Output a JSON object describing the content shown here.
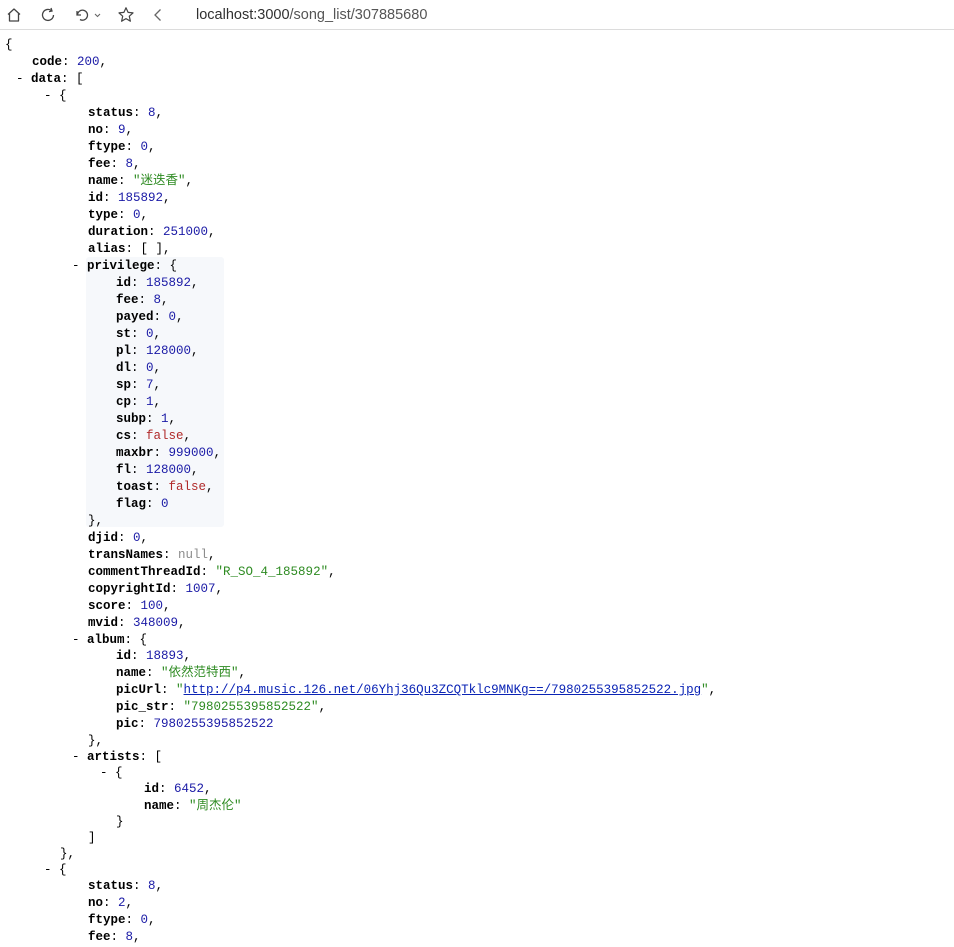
{
  "browser": {
    "url_host": "localhost:3000",
    "url_path": "/song_list/307885680",
    "icons": [
      "home-icon",
      "refresh-icon",
      "undo-icon",
      "star-icon",
      "back-icon"
    ]
  },
  "json_view": {
    "keys": {
      "code": "code",
      "data": "data",
      "status": "status",
      "no": "no",
      "ftype": "ftype",
      "fee": "fee",
      "name": "name",
      "id": "id",
      "type": "type",
      "duration": "duration",
      "alias": "alias",
      "privilege": "privilege",
      "payed": "payed",
      "st": "st",
      "pl": "pl",
      "dl": "dl",
      "sp": "sp",
      "cp": "cp",
      "subp": "subp",
      "cs": "cs",
      "maxbr": "maxbr",
      "fl": "fl",
      "toast": "toast",
      "flag": "flag",
      "djid": "djid",
      "transNames": "transNames",
      "commentThreadId": "commentThreadId",
      "copyrightId": "copyrightId",
      "score": "score",
      "mvid": "mvid",
      "album": "album",
      "picUrl": "picUrl",
      "pic_str": "pic_str",
      "pic": "pic",
      "artists": "artists"
    },
    "code": "200",
    "song1": {
      "status": "8",
      "no": "9",
      "ftype": "0",
      "fee": "8",
      "name": "\"迷迭香\"",
      "id": "185892",
      "type": "0",
      "duration": "251000",
      "alias": "[ ]",
      "privilege": {
        "id": "185892",
        "fee": "8",
        "payed": "0",
        "st": "0",
        "pl": "128000",
        "dl": "0",
        "sp": "7",
        "cp": "1",
        "subp": "1",
        "cs": "false",
        "maxbr": "999000",
        "fl": "128000",
        "toast": "false",
        "flag": "0"
      },
      "djid": "0",
      "transNames": "null",
      "commentThreadId": "\"R_SO_4_185892\"",
      "copyrightId": "1007",
      "score": "100",
      "mvid": "348009",
      "album": {
        "id": "18893",
        "name": "\"依然范特西\"",
        "picUrl": "http://p4.music.126.net/06Yhj36Qu3ZCQTklc9MNKg==/7980255395852522.jpg",
        "pic_str": "\"7980255395852522\"",
        "pic": "7980255395852522"
      },
      "artist": {
        "id": "6452",
        "name": "\"周杰伦\""
      }
    },
    "song2": {
      "status": "8",
      "no": "2",
      "ftype": "0",
      "fee": "8"
    }
  }
}
